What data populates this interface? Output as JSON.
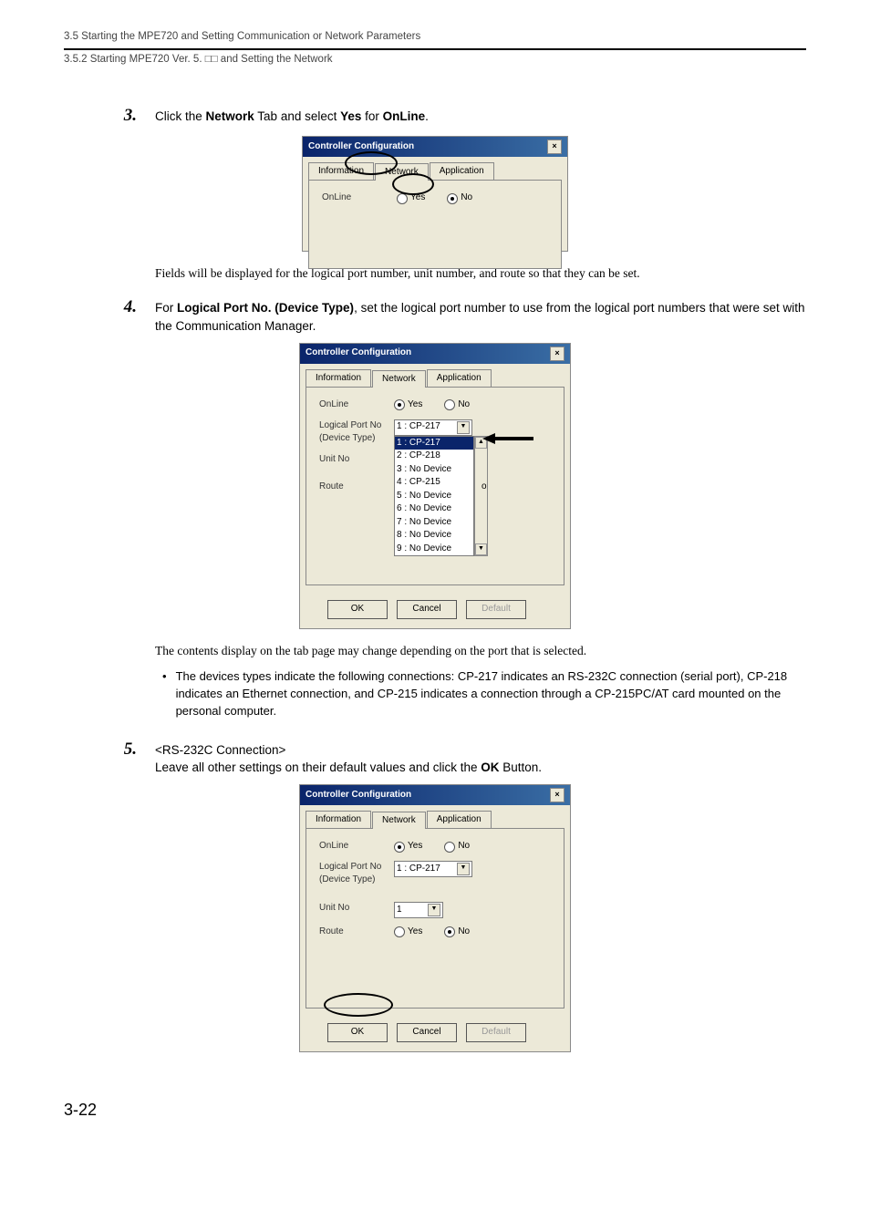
{
  "header": {
    "breadcrumb": "3.5  Starting the MPE720 and Setting Communication or Network Parameters",
    "sub": "3.5.2  Starting MPE720 Ver. 5. □□ and Setting the Network"
  },
  "step3": {
    "num": "3.",
    "text_pre": "Click the ",
    "text_b1": "Network",
    "text_mid": " Tab and select ",
    "text_b2": "Yes",
    "text_mid2": " for ",
    "text_b3": "OnLine",
    "text_post": ".",
    "note": "Fields will be displayed for the logical port number, unit number, and route so that they can be set."
  },
  "dlg1": {
    "title": "Controller Configuration",
    "tabs": {
      "info": "Information",
      "net": "Network",
      "app": "Application"
    },
    "online_label": "OnLine",
    "yes": "Yes",
    "no": "No"
  },
  "step4": {
    "num": "4.",
    "text_pre": "For ",
    "text_b1": "Logical Port No. (Device Type)",
    "text_post": ", set the logical port number to use from the logical port numbers that were set with the Communication Manager.",
    "note": "The contents display on the tab page may change depending on the port that is selected.",
    "bullet": "The devices types indicate the following connections: CP-217 indicates an RS-232C connection (serial port), CP-218 indicates an Ethernet connection, and CP-215 indicates a connection through a CP-215PC/AT card mounted on the personal computer."
  },
  "dlg2": {
    "title": "Controller Configuration",
    "tabs": {
      "info": "Information",
      "net": "Network",
      "app": "Application"
    },
    "online_label": "OnLine",
    "yes": "Yes",
    "no": "No",
    "logical_label": "Logical Port No\n(Device Type)",
    "logical_value": "1 : CP-217",
    "options": [
      "1 : CP-217",
      "2 : CP-218",
      "3 : No Device",
      "4 : CP-215",
      "5 : No Device",
      "6 : No Device",
      "7 : No Device",
      "8 : No Device",
      "9 : No Device"
    ],
    "unit_label": "Unit No",
    "route_label": "Route",
    "route_o": "o",
    "ok": "OK",
    "cancel": "Cancel",
    "default": "Default"
  },
  "step5": {
    "num": "5.",
    "text_b1": "<RS-232C Connection>",
    "line2_pre": "Leave all other settings on their default values and click the ",
    "line2_b": "OK",
    "line2_post": " Button."
  },
  "dlg3": {
    "title": "Controller Configuration",
    "tabs": {
      "info": "Information",
      "net": "Network",
      "app": "Application"
    },
    "online_label": "OnLine",
    "yes": "Yes",
    "no": "No",
    "logical_label": "Logical Port No\n(Device Type)",
    "logical_value": "1 : CP-217",
    "unit_label": "Unit No",
    "unit_value": "1",
    "route_label": "Route",
    "ok": "OK",
    "cancel": "Cancel",
    "default": "Default"
  },
  "page_num": "3-22"
}
